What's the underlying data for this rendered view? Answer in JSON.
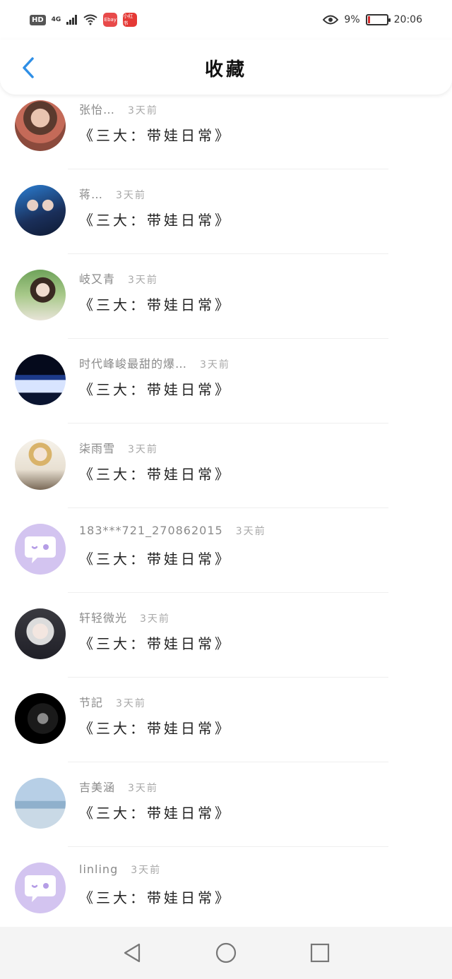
{
  "status": {
    "hd": "HD",
    "network": "4G",
    "battery_percent": "9%",
    "time": "20:06",
    "app_badge_1": "Ebay",
    "app_badge_2": "小红书"
  },
  "header": {
    "title": "收藏"
  },
  "items": [
    {
      "name": "张怡…",
      "time": "3天前",
      "content": "《三大：带娃日常》"
    },
    {
      "name": "蒋…",
      "time": "3天前",
      "content": "《三大：带娃日常》"
    },
    {
      "name": "岐又青",
      "time": "3天前",
      "content": "《三大：带娃日常》"
    },
    {
      "name": "时代峰峻最甜的爆…",
      "time": "3天前",
      "content": "《三大：带娃日常》"
    },
    {
      "name": "柒雨雪",
      "time": "3天前",
      "content": "《三大：带娃日常》"
    },
    {
      "name": "183***721_270862015",
      "time": "3天前",
      "content": "《三大：带娃日常》"
    },
    {
      "name": "轩轻微光",
      "time": "3天前",
      "content": "《三大：带娃日常》"
    },
    {
      "name": "节記",
      "time": "3天前",
      "content": "《三大：带娃日常》"
    },
    {
      "name": "吉美涵",
      "time": "3天前",
      "content": "《三大：带娃日常》"
    },
    {
      "name": "linling",
      "time": "3天前",
      "content": "《三大：带娃日常》"
    }
  ],
  "colors": {
    "accent": "#2f8fe6",
    "avatar_default": "#d3c4f0"
  }
}
